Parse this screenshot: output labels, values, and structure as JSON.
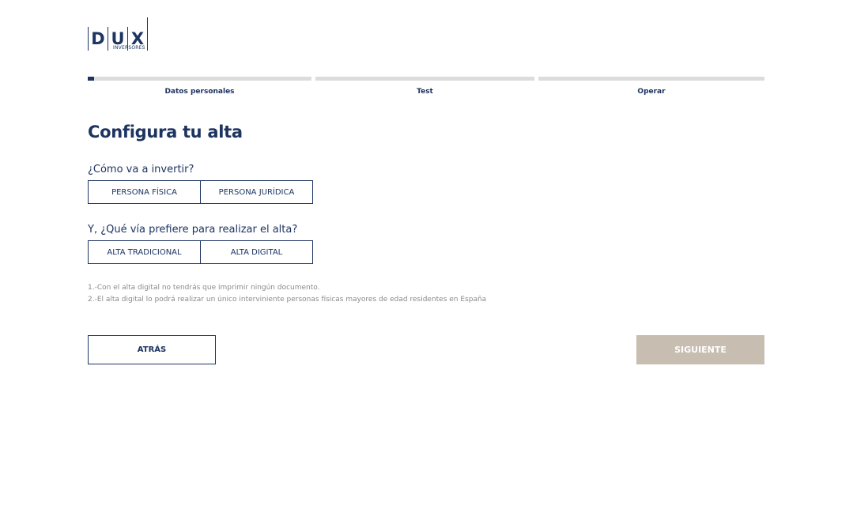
{
  "logo": {
    "letters": [
      "D",
      "U",
      "X"
    ],
    "subtitle": "INVERSORES"
  },
  "progress": {
    "steps": [
      {
        "label": "Datos personales",
        "progress": 0.03
      },
      {
        "label": "Test",
        "progress": 0
      },
      {
        "label": "Operar",
        "progress": 0
      }
    ]
  },
  "main": {
    "title": "Configura tu alta",
    "question1": "¿Cómo va a invertir?",
    "options1": [
      "PERSONA FÍSICA",
      "PERSONA JURÍDICA"
    ],
    "question2": "Y, ¿Qué vía prefiere para realizar el alta?",
    "options2": [
      "ALTA TRADICIONAL",
      "ALTA DIGITAL"
    ],
    "notes": [
      "1.-Con el alta digital no tendrás que imprimir ningún documento.",
      "2.-El alta digital lo podrá realizar un único interviniente personas físicas mayores de edad residentes en España"
    ]
  },
  "buttons": {
    "back": "ATRÁS",
    "next": "SIGUIENTE"
  },
  "colors": {
    "brand": "#1d3461",
    "track": "#dcdcdc",
    "next_disabled": "#c7bdb1",
    "note_text": "#8a8a8a"
  }
}
